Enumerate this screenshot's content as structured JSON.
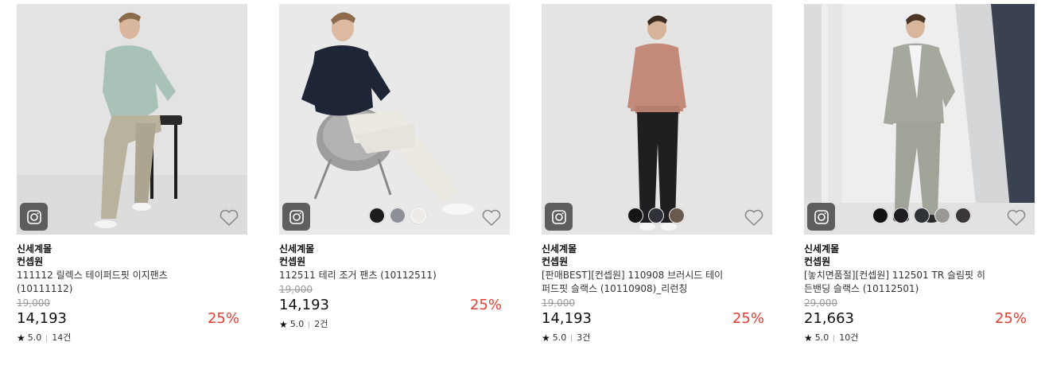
{
  "products": [
    {
      "brand": "신세계몰",
      "maker": "컨셉원",
      "name": "111112 릴렉스 테이퍼드핏 이지팬츠 (10111112)",
      "original_price": "19,000",
      "price": "14,193",
      "discount": "25%",
      "rating": "5.0",
      "reviews": "14건",
      "image_icon": "instagram-icon",
      "swatches": [],
      "wishlist_icon": "heart-outline-icon"
    },
    {
      "brand": "신세계몰",
      "maker": "컨셉원",
      "name": "112511 테리 조거 팬츠 (10112511)",
      "original_price": "19,000",
      "price": "14,193",
      "discount": "25%",
      "rating": "5.0",
      "reviews": "2건",
      "image_icon": "instagram-icon",
      "swatches": [
        "#1c1c1e",
        "#8c8f96",
        "#ecebe8"
      ],
      "wishlist_icon": "heart-outline-icon"
    },
    {
      "brand": "신세계몰",
      "maker": "컨셉원",
      "name": "[판매BEST][컨셉원] 110908 브러시드 테이퍼드핏 슬랙스 (10110908)_리런칭",
      "original_price": "19,000",
      "price": "14,193",
      "discount": "25%",
      "rating": "5.0",
      "reviews": "3건",
      "image_icon": "instagram-icon",
      "swatches": [
        "#151515",
        "#2f3238",
        "#6a5a4e"
      ],
      "wishlist_icon": "heart-outline-icon"
    },
    {
      "brand": "신세계몰",
      "maker": "컨셉원",
      "name": "[놓치면품절][컨셉원] 112501 TR 슬림핏 히든밴딩 슬랙스 (10112501)",
      "original_price": "29,000",
      "price": "21,663",
      "discount": "25%",
      "rating": "5.0",
      "reviews": "10건",
      "image_icon": "instagram-icon",
      "swatches": [
        "#121212",
        "#1f1c22",
        "#2e3338",
        "#9a9896",
        "#3a3736"
      ],
      "wishlist_icon": "heart-outline-icon"
    }
  ],
  "colors": {
    "discount": "#e63c32",
    "original_price": "#999999"
  }
}
